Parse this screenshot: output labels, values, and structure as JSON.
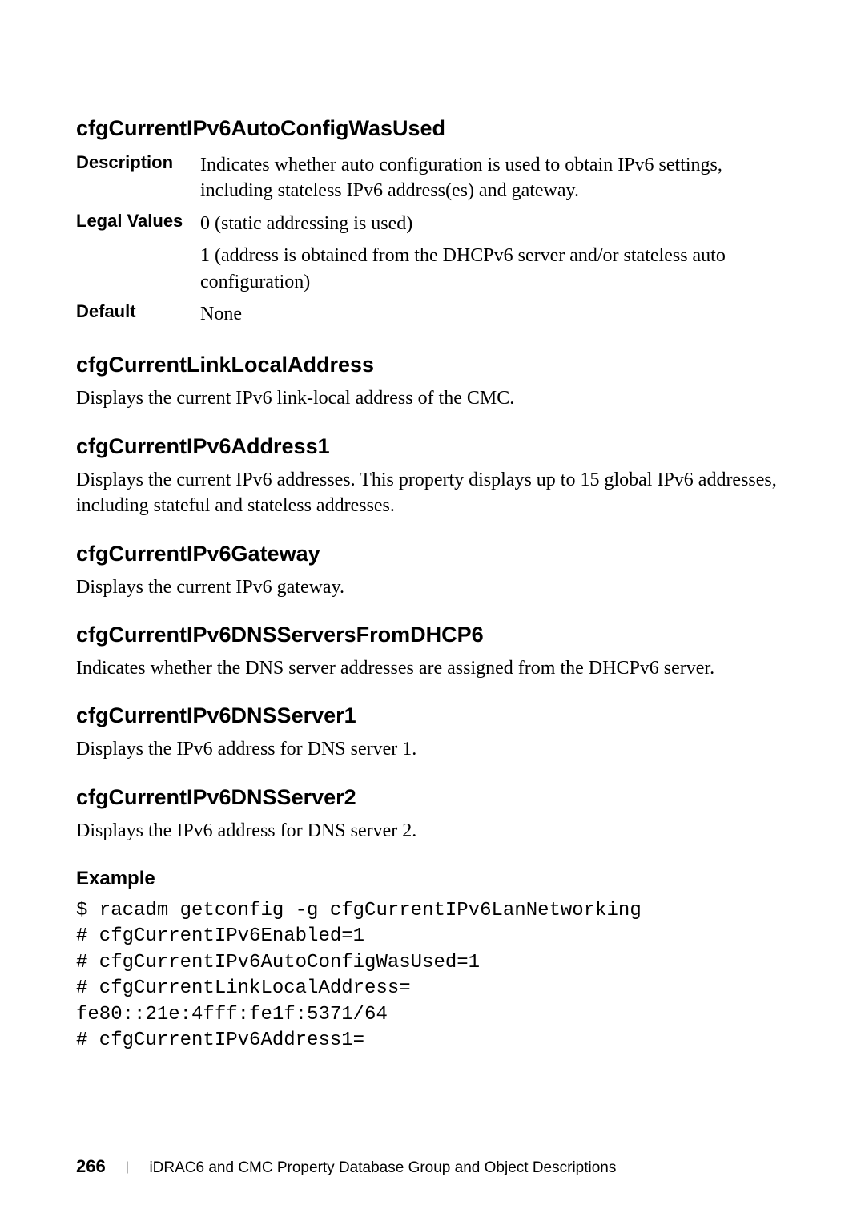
{
  "sections": {
    "s1": {
      "heading": "cfgCurrentIPv6AutoConfigWasUsed",
      "defs": {
        "description": {
          "label": "Description",
          "value": "Indicates whether auto configuration is used to obtain IPv6 settings, including stateless IPv6 address(es) and gateway."
        },
        "legalValues": {
          "label": "Legal Values",
          "line1": "0 (static addressing is used)",
          "line2": "1 (address is obtained from the DHCPv6 server and/or stateless auto configuration)"
        },
        "default": {
          "label": "Default",
          "value": "None"
        }
      }
    },
    "s2": {
      "heading": "cfgCurrentLinkLocalAddress",
      "body": "Displays the current IPv6 link-local address of the CMC."
    },
    "s3": {
      "heading": "cfgCurrentIPv6Address1",
      "body": "Displays the current IPv6 addresses. This property displays up to 15 global IPv6 addresses, including stateful and stateless addresses."
    },
    "s4": {
      "heading": "cfgCurrentIPv6Gateway",
      "body": "Displays the current IPv6 gateway."
    },
    "s5": {
      "heading": "cfgCurrentIPv6DNSServersFromDHCP6",
      "body": "Indicates whether the DNS server addresses are assigned from the DHCPv6 server."
    },
    "s6": {
      "heading": "cfgCurrentIPv6DNSServer1",
      "body": "Displays the IPv6 address for DNS server 1."
    },
    "s7": {
      "heading": "cfgCurrentIPv6DNSServer2",
      "body": "Displays the IPv6 address for DNS server 2."
    },
    "example": {
      "heading": "Example",
      "code": "$ racadm getconfig -g cfgCurrentIPv6LanNetworking\n# cfgCurrentIPv6Enabled=1\n# cfgCurrentIPv6AutoConfigWasUsed=1\n# cfgCurrentLinkLocalAddress=\nfe80::21e:4fff:fe1f:5371/64\n# cfgCurrentIPv6Address1="
    }
  },
  "footer": {
    "page": "266",
    "title": "iDRAC6 and CMC Property Database Group and Object Descriptions"
  }
}
